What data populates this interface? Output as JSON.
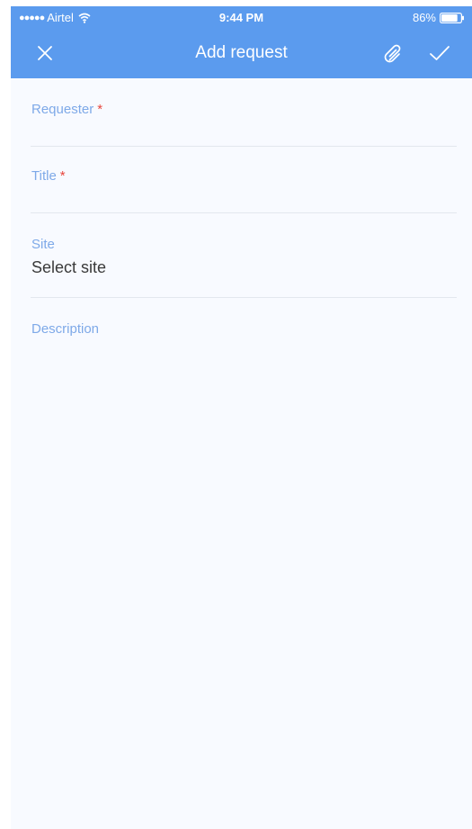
{
  "status_bar": {
    "signal_dots": "●●●●●",
    "carrier": "Airtel",
    "time": "9:44 PM",
    "battery": "86%",
    "battery_level": 0.86,
    "icons": [
      "wifi-icon",
      "battery-icon"
    ]
  },
  "nav": {
    "title": "Add request",
    "left_icon": "close-icon",
    "right_icons": [
      "paperclip-icon",
      "checkmark-icon"
    ]
  },
  "form": {
    "requester": {
      "label": "Requester",
      "required_mark": "*",
      "value": ""
    },
    "title": {
      "label": "Title",
      "required_mark": "*",
      "value": ""
    },
    "site": {
      "label": "Site",
      "value": "Select site"
    },
    "description": {
      "label": "Description",
      "value": ""
    }
  },
  "colors": {
    "header": "#5b9bee",
    "label": "#7ea9e8",
    "required": "#e8453c",
    "background": "#f8faff",
    "divider": "#e3e7ee"
  }
}
